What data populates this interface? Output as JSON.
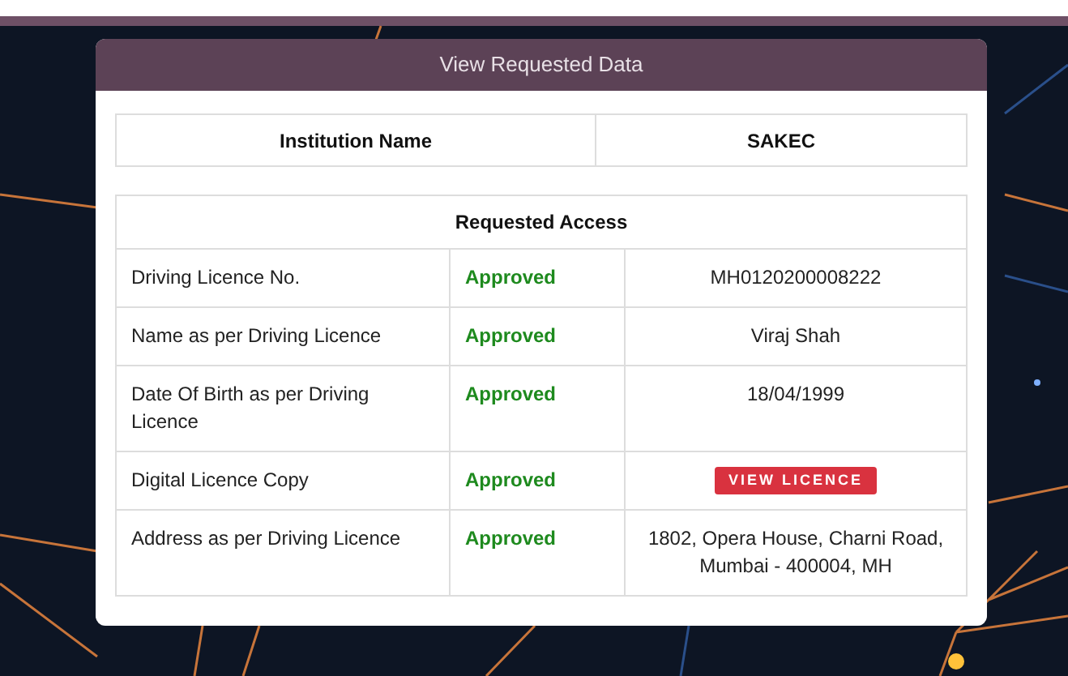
{
  "dialog": {
    "title": "View Requested Data"
  },
  "institution": {
    "label": "Institution Name",
    "value": "SAKEC"
  },
  "access_table": {
    "title": "Requested Access",
    "rows": [
      {
        "field": "Driving Licence No.",
        "status": {
          "text": "Approved",
          "kind": "approved"
        },
        "kind": "text",
        "value": "MH0120200008222"
      },
      {
        "field": "Name as per Driving Licence",
        "status": {
          "text": "Approved",
          "kind": "approved"
        },
        "kind": "text",
        "value": "Viraj Shah"
      },
      {
        "field": "Date Of Birth as per Driving Licence",
        "status": {
          "text": "Approved",
          "kind": "approved"
        },
        "kind": "text",
        "value": "18/04/1999"
      },
      {
        "field": "Digital Licence Copy",
        "status": {
          "text": "Approved",
          "kind": "approved"
        },
        "kind": "button",
        "value": "VIEW LICENCE"
      },
      {
        "field": "Address as per Driving Licence",
        "status": {
          "text": "Approved",
          "kind": "approved"
        },
        "kind": "text",
        "value": "1802, Opera House, Charni Road, Mumbai - 400004, MH"
      }
    ]
  }
}
